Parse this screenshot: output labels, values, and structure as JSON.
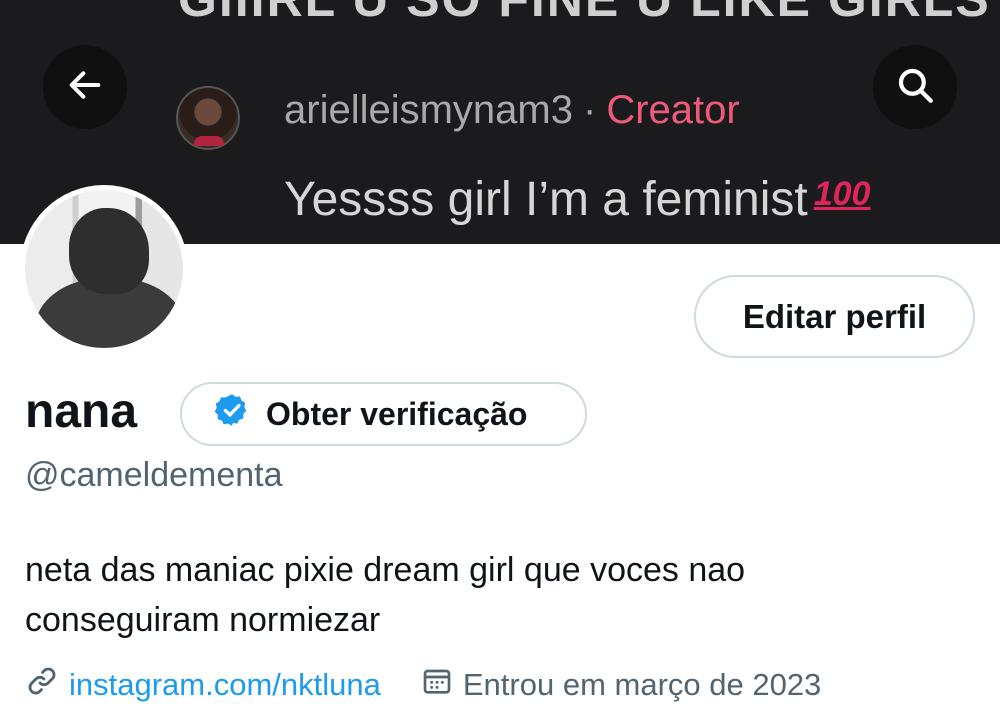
{
  "banner": {
    "caption": "GIIIRL U SO FINE U LIKE GIRLS?",
    "comment_user": "arielleismynam3",
    "comment_separator": "·",
    "comment_role": "Creator",
    "comment_text": "Yessss girl I’m a feminist",
    "comment_emoji": "100"
  },
  "nav": {
    "back_icon": "arrow-left-icon",
    "search_icon": "search-icon"
  },
  "profile": {
    "display_name": "nana",
    "handle": "@cameldementa",
    "edit_label": "Editar perfil",
    "verify_label": "Obter verificação",
    "bio_line1": "neta das maniac pixie dream girl que voces nao",
    "bio_line2": "conseguiram normiezar",
    "link": "instagram.com/nktluna",
    "joined": "Entrou em março de 2023"
  },
  "colors": {
    "accent": "#1d9bf0",
    "secondary_text": "#536471",
    "border": "#cfd9de",
    "creator_label": "#f05a7a"
  }
}
